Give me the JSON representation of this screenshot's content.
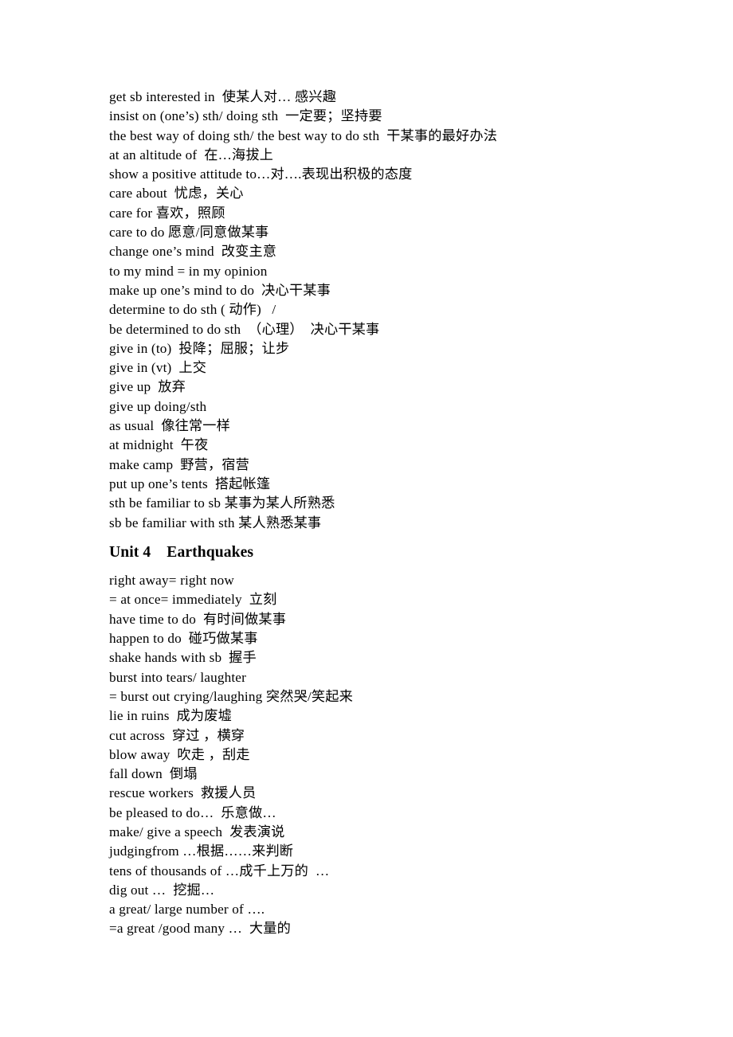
{
  "document": {
    "background_color": "#ffffff",
    "text_color": "#000000",
    "sections": [
      {
        "id": "unit-3-continued",
        "heading": null,
        "lines": [
          "get sb interested in  使某人对… 感兴趣",
          "insist on (one’s) sth/ doing sth  一定要；坚持要",
          "the best way of doing sth/ the best way to do sth  干某事的最好办法",
          "at an altitude of  在…海拔上",
          "show a positive attitude to…对….表现出积极的态度",
          "care about  忧虑，关心",
          "care for 喜欢，照顾",
          "care to do 愿意/同意做某事",
          "change one’s mind  改变主意",
          "to my mind = in my opinion",
          "make up one’s mind to do  决心干某事",
          "determine to do sth ( 动作)   /",
          "be determined to do sth  （心理）  决心干某事",
          "give in (to)  投降；屈服；让步",
          "give in (vt)  上交",
          "give up  放弃",
          "give up doing/sth",
          "as usual  像往常一样",
          "at midnight  午夜",
          "make camp  野营，宿营",
          "put up one’s tents  搭起帐篷",
          "sth be familiar to sb 某事为某人所熟悉",
          "sb be familiar with sth 某人熟悉某事"
        ]
      },
      {
        "id": "unit-4",
        "heading": "Unit 4    Earthquakes",
        "lines": [
          "right away= right now",
          "= at once= immediately  立刻",
          "have time to do  有时间做某事",
          "happen to do  碰巧做某事",
          "shake hands with sb  握手",
          "burst into tears/ laughter",
          "= burst out crying/laughing 突然哭/笑起来",
          "lie in ruins  成为废墟",
          "cut across  穿过 ，横穿",
          "blow away  吹走 ，刮走",
          "fall down  倒塌",
          "rescue workers  救援人员",
          "be pleased to do…  乐意做…",
          "make/ give a speech  发表演说",
          "judgingfrom …根据……来判断",
          "tens of thousands of …成千上万的  …",
          "dig out …  挖掘…",
          "a great/ large number of ….",
          "=a great /good many …  大量的"
        ]
      }
    ]
  }
}
